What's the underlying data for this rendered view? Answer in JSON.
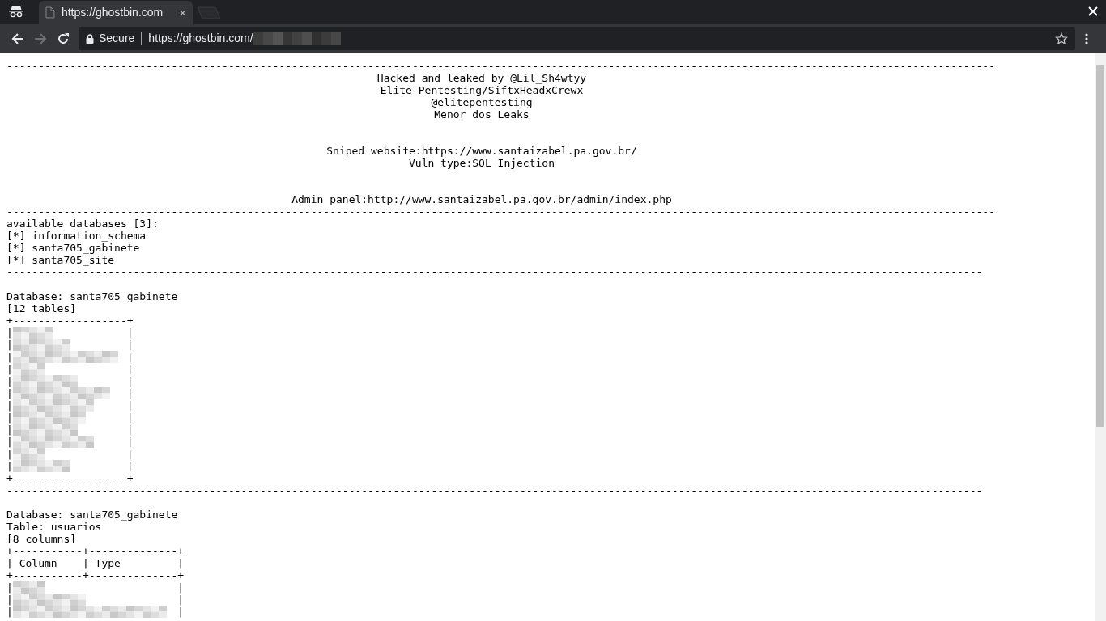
{
  "browser": {
    "tab": {
      "title": "https://ghostbin.com",
      "close": "×"
    },
    "address_bar": {
      "security": "Secure",
      "url": "https://ghostbin.com/"
    }
  },
  "paste": {
    "lines": [
      {
        "kind": "rule",
        "text": "------------------------------------------------------------------------------------------------------------------------------------------------------------"
      },
      {
        "kind": "centered",
        "text": "Hacked and leaked by @Lil_Sh4wtyy"
      },
      {
        "kind": "centered",
        "text": "Elite Pentesting/SiftxHeadxCrewx"
      },
      {
        "kind": "centered",
        "text": "@elitepentesting"
      },
      {
        "kind": "centered",
        "text": "Menor dos Leaks"
      },
      {
        "kind": "blank"
      },
      {
        "kind": "blank"
      },
      {
        "kind": "centered",
        "text": "Sniped website:https://www.santaizabel.pa.gov.br/"
      },
      {
        "kind": "centered",
        "text": "Vuln type:SQL Injection"
      },
      {
        "kind": "blank"
      },
      {
        "kind": "blank"
      },
      {
        "kind": "centered",
        "text": "Admin panel:http://www.santaizabel.pa.gov.br/admin/index.php"
      },
      {
        "kind": "rule",
        "text": "------------------------------------------------------------------------------------------------------------------------------------------------------------"
      },
      {
        "kind": "text",
        "text": "available databases [3]:"
      },
      {
        "kind": "text",
        "text": "[*] information_schema"
      },
      {
        "kind": "text",
        "text": "[*] santa705_gabinete"
      },
      {
        "kind": "text",
        "text": "[*] santa705_site"
      },
      {
        "kind": "rule",
        "text": "----------------------------------------------------------------------------------------------------------------------------------------------------------"
      },
      {
        "kind": "blank"
      },
      {
        "kind": "text",
        "text": "Database: santa705_gabinete"
      },
      {
        "kind": "text",
        "text": "[12 tables]"
      },
      {
        "kind": "border",
        "text": "+------------------+"
      },
      {
        "kind": "redacted",
        "left": "|",
        "right": "|"
      },
      {
        "kind": "redacted",
        "left": "|",
        "right": "|"
      },
      {
        "kind": "redacted",
        "left": "|",
        "right": "|"
      },
      {
        "kind": "redacted",
        "left": "|",
        "right": "|"
      },
      {
        "kind": "redacted",
        "left": "|",
        "right": "|"
      },
      {
        "kind": "redacted",
        "left": "|",
        "right": "|"
      },
      {
        "kind": "redacted",
        "left": "|",
        "right": "|"
      },
      {
        "kind": "redacted",
        "left": "|",
        "right": "|"
      },
      {
        "kind": "redacted",
        "left": "|",
        "right": "|"
      },
      {
        "kind": "redacted",
        "left": "|",
        "right": "|"
      },
      {
        "kind": "redacted",
        "left": "|",
        "right": "|"
      },
      {
        "kind": "redacted",
        "left": "|",
        "right": "|"
      },
      {
        "kind": "border",
        "text": "+------------------+"
      },
      {
        "kind": "rule",
        "text": "----------------------------------------------------------------------------------------------------------------------------------------------------------"
      },
      {
        "kind": "blank"
      },
      {
        "kind": "text",
        "text": "Database: santa705_gabinete"
      },
      {
        "kind": "text",
        "text": "Table: usuarios"
      },
      {
        "kind": "text",
        "text": "[8 columns]"
      },
      {
        "kind": "border",
        "text": "+-----------+--------------+"
      },
      {
        "kind": "header",
        "text": "| Column    | Type         |"
      },
      {
        "kind": "border",
        "text": "+-----------+--------------+"
      },
      {
        "kind": "redacted",
        "left": "|",
        "right": "|"
      },
      {
        "kind": "redacted",
        "left": "|",
        "right": "|"
      },
      {
        "kind": "redacted",
        "left": "|",
        "right": "|"
      }
    ]
  }
}
